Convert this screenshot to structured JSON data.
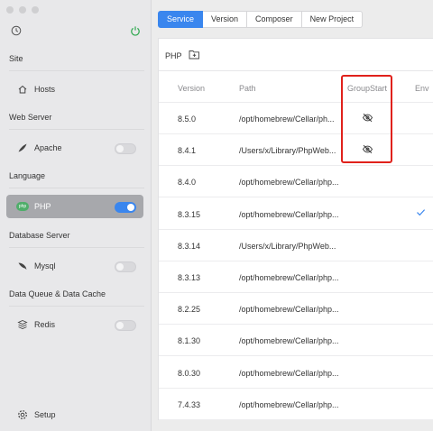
{
  "sidebar": {
    "top_icons": {
      "left": "clock-icon",
      "right": "power-icon"
    },
    "sections": [
      {
        "title": "Site",
        "items": [
          {
            "label": "Hosts",
            "icon": "home-icon",
            "toggle": null
          }
        ]
      },
      {
        "title": "Web Server",
        "items": [
          {
            "label": "Apache",
            "icon": "feather-icon",
            "toggle": false
          }
        ]
      },
      {
        "title": "Language",
        "items": [
          {
            "label": "PHP",
            "icon": "php-icon",
            "toggle": true
          }
        ]
      },
      {
        "title": "Database Server",
        "items": [
          {
            "label": "Mysql",
            "icon": "dolphin-icon",
            "toggle": false
          }
        ]
      },
      {
        "title": "Data Queue & Data Cache",
        "items": [
          {
            "label": "Redis",
            "icon": "stack-icon",
            "toggle": false
          }
        ]
      }
    ],
    "setup_label": "Setup",
    "php_badge": "php"
  },
  "tabs": [
    "Service",
    "Version",
    "Composer",
    "New Project"
  ],
  "active_tab": "Service",
  "panel": {
    "title": "PHP",
    "headers": {
      "version": "Version",
      "path": "Path",
      "group_start": "GroupStart",
      "env": "Env"
    },
    "rows": [
      {
        "version": "8.5.0",
        "path": "/opt/homebrew/Cellar/ph...",
        "group_start_icon": true,
        "env": false
      },
      {
        "version": "8.4.1",
        "path": "/Users/x/Library/PhpWeb...",
        "group_start_icon": true,
        "env": false
      },
      {
        "version": "8.4.0",
        "path": "/opt/homebrew/Cellar/php...",
        "group_start_icon": false,
        "env": false
      },
      {
        "version": "8.3.15",
        "path": "/opt/homebrew/Cellar/php...",
        "group_start_icon": false,
        "env": true
      },
      {
        "version": "8.3.14",
        "path": "/Users/x/Library/PhpWeb...",
        "group_start_icon": false,
        "env": false
      },
      {
        "version": "8.3.13",
        "path": "/opt/homebrew/Cellar/php...",
        "group_start_icon": false,
        "env": false
      },
      {
        "version": "8.2.25",
        "path": "/opt/homebrew/Cellar/php...",
        "group_start_icon": false,
        "env": false
      },
      {
        "version": "8.1.30",
        "path": "/opt/homebrew/Cellar/php...",
        "group_start_icon": false,
        "env": false
      },
      {
        "version": "8.0.30",
        "path": "/opt/homebrew/Cellar/php...",
        "group_start_icon": false,
        "env": false
      },
      {
        "version": "7.4.33",
        "path": "/opt/homebrew/Cellar/php...",
        "group_start_icon": false,
        "env": false
      }
    ]
  },
  "colors": {
    "accent": "#3a86ee",
    "highlight": "#e0211b",
    "power": "#2fa84f"
  }
}
